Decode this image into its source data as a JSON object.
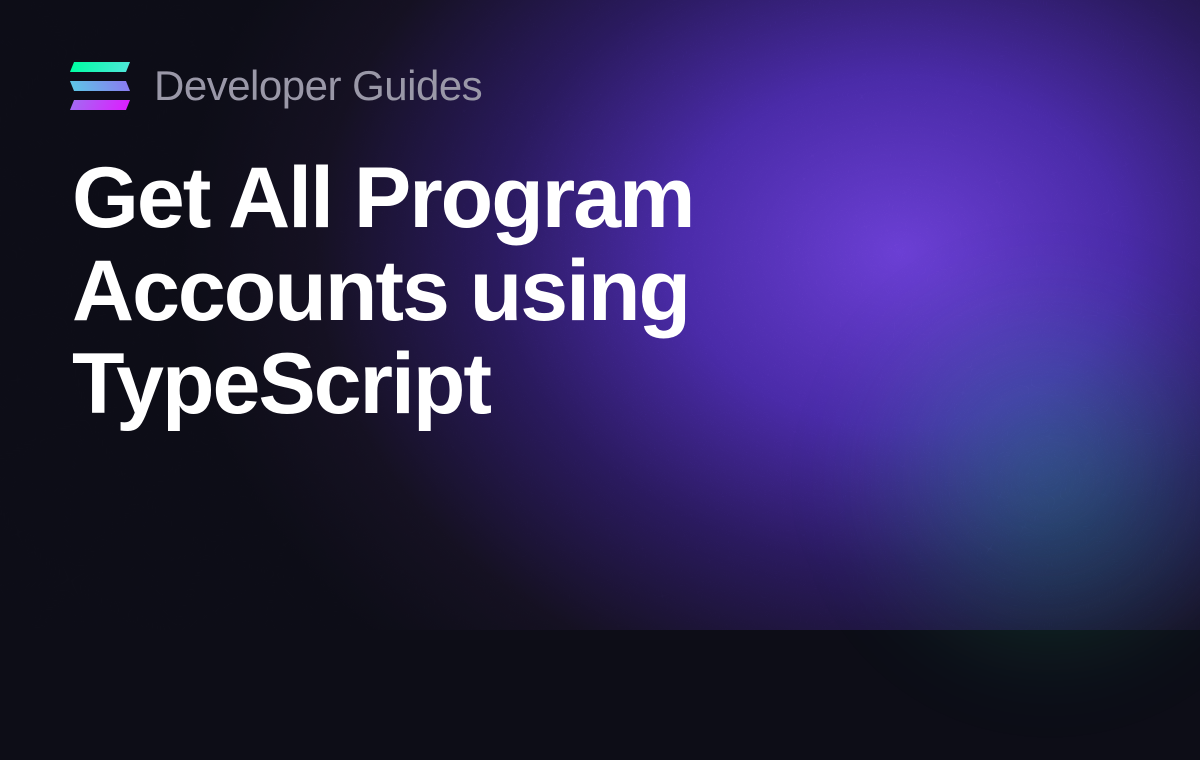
{
  "header": {
    "subtitle": "Developer Guides"
  },
  "main": {
    "title": "Get All Program Accounts using TypeScript"
  },
  "brand": {
    "gradient_colors": [
      "#00ffa3",
      "#dc1fff"
    ],
    "accent_purple": "#6b3fd4",
    "accent_green": "#14f195"
  }
}
